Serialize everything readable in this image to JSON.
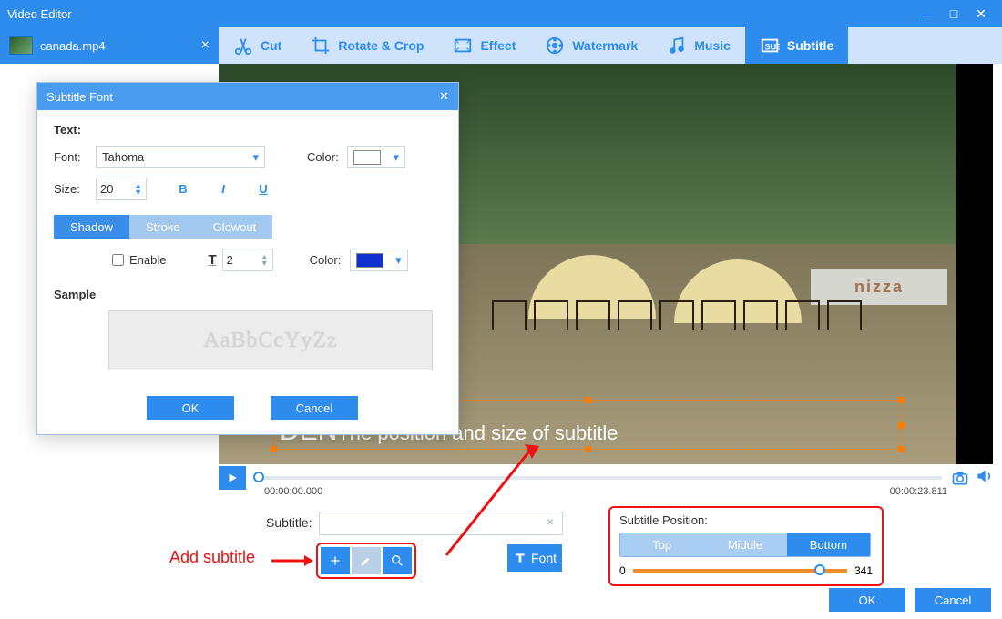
{
  "app": {
    "title": "Video Editor"
  },
  "file": {
    "name": "canada.mp4"
  },
  "tools": {
    "cut": "Cut",
    "rotate": "Rotate & Crop",
    "effect": "Effect",
    "watermark": "Watermark",
    "music": "Music",
    "subtitle": "Subtitle"
  },
  "preview": {
    "sign": "nizza",
    "subtitle_big": "DEN",
    "subtitle_line": "The position and size of subtitle"
  },
  "timeline": {
    "start": "00:00:00.000",
    "end": "00:00:23.811"
  },
  "subtitle_input": {
    "label": "Subtitle:",
    "value": "",
    "placeholder": ""
  },
  "font_btn": "Font",
  "annot": {
    "add_subtitle": "Add subtitle"
  },
  "position_panel": {
    "label": "Subtitle Position:",
    "top": "Top",
    "middle": "Middle",
    "bottom": "Bottom",
    "min": "0",
    "value": "341"
  },
  "buttons": {
    "ok": "OK",
    "cancel": "Cancel"
  },
  "dialog": {
    "title": "Subtitle Font",
    "text_label": "Text:",
    "font_label": "Font:",
    "font_value": "Tahoma",
    "color_label": "Color:",
    "size_label": "Size:",
    "size_value": "20",
    "bold": "B",
    "italic": "I",
    "underline": "U",
    "tab_shadow": "Shadow",
    "tab_stroke": "Stroke",
    "tab_glowout": "Glowout",
    "enable": "Enable",
    "shadow_size": "2",
    "shadow_color": "#1030d0",
    "sample_label": "Sample",
    "sample_text": "AaBbCcYyZz",
    "ok": "OK",
    "cancel": "Cancel"
  }
}
